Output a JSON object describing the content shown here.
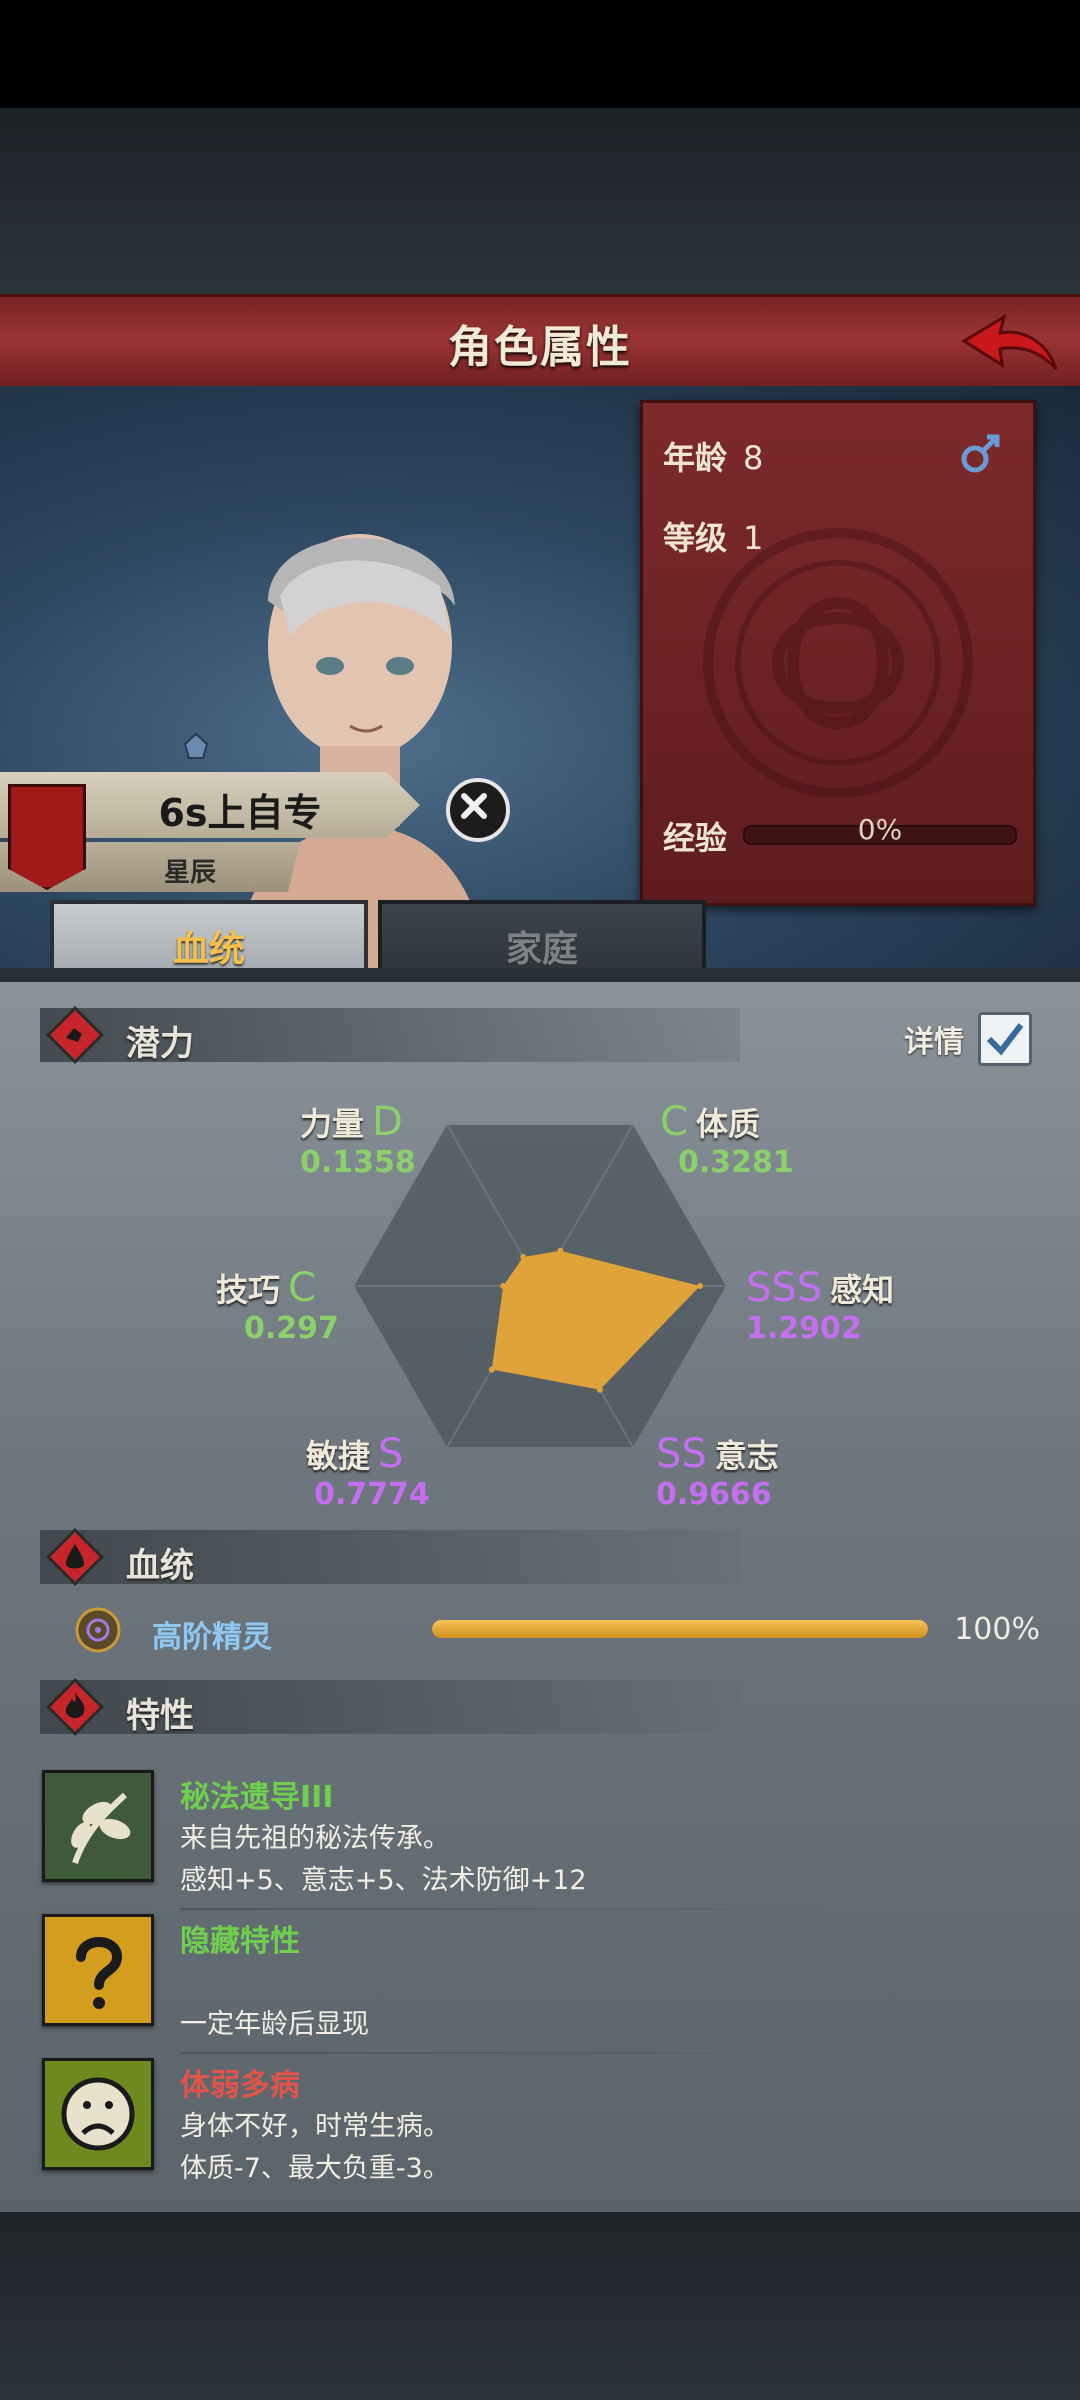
{
  "header": {
    "title": "角色属性"
  },
  "stats": {
    "age_label": "年龄",
    "age_value": "8",
    "level_label": "等级",
    "level_value": "1",
    "exp_label": "经验",
    "exp_value": "0%",
    "exp_fraction": 0,
    "gender_icon": "male-symbol-icon"
  },
  "character": {
    "name": "6s上自专",
    "subtitle": "星辰"
  },
  "tabs": [
    {
      "label": "血统"
    },
    {
      "label": "家庭"
    }
  ],
  "potential": {
    "section_label": "潜力",
    "details_label": "详情",
    "details_checked": true,
    "attributes": [
      {
        "name": "力量",
        "grade": "D",
        "value": "0.1358",
        "color": "green"
      },
      {
        "name": "体质",
        "grade": "C",
        "value": "0.3281",
        "color": "green"
      },
      {
        "name": "感知",
        "grade": "SSS",
        "value": "1.2902",
        "color": "purple"
      },
      {
        "name": "意志",
        "grade": "SS",
        "value": "0.9666",
        "color": "purple"
      },
      {
        "name": "敏捷",
        "grade": "S",
        "value": "0.7774",
        "color": "purple"
      },
      {
        "name": "技巧",
        "grade": "C",
        "value": "0.297",
        "color": "green"
      }
    ]
  },
  "lineage": {
    "section_label": "血统",
    "name": "高阶精灵",
    "percent": "100%",
    "fraction": 1
  },
  "traits": {
    "section_label": "特性",
    "items": [
      {
        "name": "秘法遗导III",
        "line1": "来自先祖的秘法传承。",
        "line2": "感知+5、意志+5、法术防御+12",
        "icon": "leaf-branch-icon",
        "name_color": "#6ed04c"
      },
      {
        "name": "隐藏特性",
        "line1": "",
        "line2": "一定年龄后显现",
        "icon": "question-mark-icon",
        "name_color": "#6ed04c"
      },
      {
        "name": "体弱多病",
        "line1": "身体不好，时常生病。",
        "line2": "体质-7、最大负重-3。",
        "icon": "sad-face-icon",
        "name_color": "#e0544a"
      }
    ]
  },
  "colors": {
    "green": "#8bd06b",
    "purple": "#c46ef0",
    "radar_fill": "#e0a33a",
    "header_red": "#9a3434"
  }
}
